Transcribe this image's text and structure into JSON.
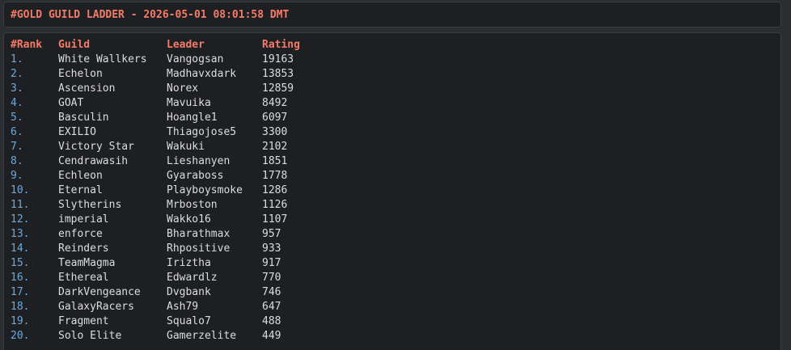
{
  "title": "#GOLD GUILD LADDER - 2026-05-01 08:01:58 DMT",
  "colors": {
    "header_text": "#f47b67",
    "rank_text": "#6fa8dc",
    "body_text": "#dcddde",
    "block_bg": "#1e1f22",
    "page_bg": "#2b2d31"
  },
  "columns": {
    "rank": "#Rank",
    "guild": "Guild",
    "leader": "Leader",
    "rating": "Rating"
  },
  "rows": [
    {
      "rank": "1.",
      "guild": "White Wallkers",
      "leader": "Vangogsan",
      "rating": "19163"
    },
    {
      "rank": "2.",
      "guild": "Echelon",
      "leader": "Madhavxdark",
      "rating": "13853"
    },
    {
      "rank": "3.",
      "guild": "Ascension",
      "leader": "Norex",
      "rating": "12859"
    },
    {
      "rank": "4.",
      "guild": "GOAT",
      "leader": "Mavuika",
      "rating": "8492"
    },
    {
      "rank": "5.",
      "guild": "Basculin",
      "leader": "Hoangle1",
      "rating": "6097"
    },
    {
      "rank": "6.",
      "guild": "EXILIO",
      "leader": "Thiagojose5",
      "rating": "3300"
    },
    {
      "rank": "7.",
      "guild": "Victory Star",
      "leader": "Wakuki",
      "rating": "2102"
    },
    {
      "rank": "8.",
      "guild": "Cendrawasih",
      "leader": "Lieshanyen",
      "rating": "1851"
    },
    {
      "rank": "9.",
      "guild": "Echleon",
      "leader": "Gyaraboss",
      "rating": "1778"
    },
    {
      "rank": "10.",
      "guild": "Eternal",
      "leader": "Playboysmoke",
      "rating": "1286"
    },
    {
      "rank": "11.",
      "guild": "Slytherins",
      "leader": "Mrboston",
      "rating": "1126"
    },
    {
      "rank": "12.",
      "guild": "imperial",
      "leader": "Wakko16",
      "rating": "1107"
    },
    {
      "rank": "13.",
      "guild": "enforce",
      "leader": "Bharathmax",
      "rating": "957"
    },
    {
      "rank": "14.",
      "guild": "Reinders",
      "leader": "Rhpositive",
      "rating": "933"
    },
    {
      "rank": "15.",
      "guild": "TeamMagma",
      "leader": "Iriztha",
      "rating": "917"
    },
    {
      "rank": "16.",
      "guild": "Ethereal",
      "leader": "Edwardlz",
      "rating": "770"
    },
    {
      "rank": "17.",
      "guild": "DarkVengeance",
      "leader": "Dvgbank",
      "rating": "746"
    },
    {
      "rank": "18.",
      "guild": "GalaxyRacers",
      "leader": "Ash79",
      "rating": "647"
    },
    {
      "rank": "19.",
      "guild": "Fragment",
      "leader": "Squalo7",
      "rating": "488"
    },
    {
      "rank": "20.",
      "guild": "Solo Elite",
      "leader": "Gamerzelite",
      "rating": "449"
    }
  ]
}
